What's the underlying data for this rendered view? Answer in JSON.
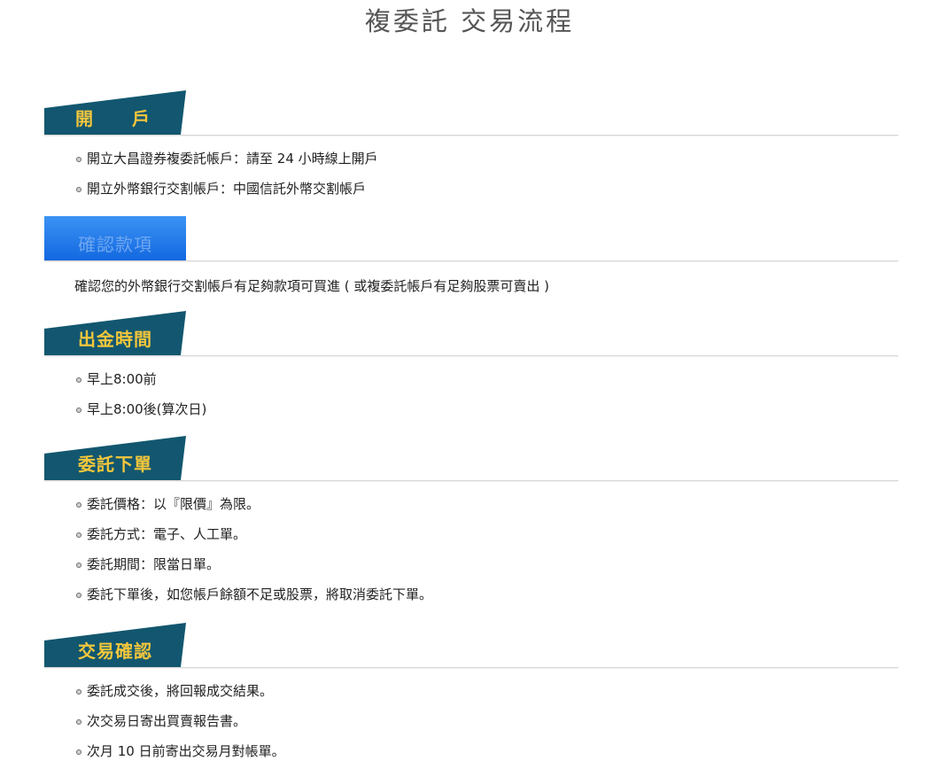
{
  "page": {
    "title": "複委託 交易流程"
  },
  "colors": {
    "tab_dark": "#12576f",
    "tab_blue": "#1a7ae8",
    "tab_text": "#f3c63c"
  },
  "sections": [
    {
      "heading": "開　戶",
      "items": [
        "開立大昌證券複委託帳戶：請至 24 小時線上開戶",
        "開立外幣銀行交割帳戶：中國信託外幣交割帳戶"
      ]
    },
    {
      "heading": "確認款項",
      "text": "確認您的外幣銀行交割帳戶有足夠款項可買進 ( 或複委託帳戶有足夠股票可賣出 )"
    },
    {
      "heading": "出金時間",
      "items": [
        "早上8:00前",
        "早上8:00後(算次日)"
      ]
    },
    {
      "heading": "委託下單",
      "items": [
        "委託價格：以『限價』為限。",
        "委託方式：電子、人工單。",
        "委託期間：限當日單。",
        "委託下單後，如您帳戶餘額不足或股票，將取消委託下單。"
      ]
    },
    {
      "heading": "交易確認",
      "items": [
        "委託成交後，將回報成交結果。",
        "次交易日寄出買賣報告書。",
        "次月 10 日前寄出交易月對帳單。"
      ]
    }
  ]
}
